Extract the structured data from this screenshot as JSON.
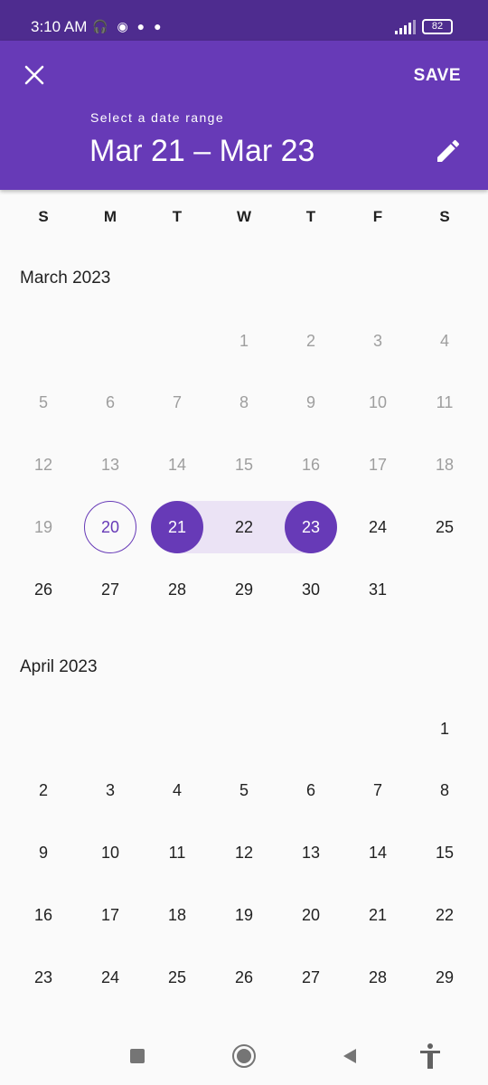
{
  "status_bar": {
    "time": "3:10 AM",
    "battery": "82"
  },
  "header": {
    "save_label": "SAVE",
    "caption": "Select a date range",
    "range_value": "Mar 21 – Mar 23"
  },
  "weekdays": [
    "S",
    "M",
    "T",
    "W",
    "T",
    "F",
    "S"
  ],
  "months": [
    {
      "title": "March 2023",
      "rows": [
        [
          "",
          "",
          "",
          "1",
          "2",
          "3",
          "4"
        ],
        [
          "5",
          "6",
          "7",
          "8",
          "9",
          "10",
          "11"
        ],
        [
          "12",
          "13",
          "14",
          "15",
          "16",
          "17",
          "18"
        ],
        [
          "19",
          "20",
          "21",
          "22",
          "23",
          "24",
          "25"
        ],
        [
          "26",
          "27",
          "28",
          "29",
          "30",
          "31",
          ""
        ]
      ]
    },
    {
      "title": "April 2023",
      "rows": [
        [
          "",
          "",
          "",
          "",
          "",
          "",
          "1"
        ],
        [
          "2",
          "3",
          "4",
          "5",
          "6",
          "7",
          "8"
        ],
        [
          "9",
          "10",
          "11",
          "12",
          "13",
          "14",
          "15"
        ],
        [
          "16",
          "17",
          "18",
          "19",
          "20",
          "21",
          "22"
        ],
        [
          "23",
          "24",
          "25",
          "26",
          "27",
          "28",
          "29"
        ]
      ]
    }
  ],
  "colors": {
    "primary": "#673ab7",
    "status_bar": "#4e2c8f",
    "range_fill": "#ebe3f5",
    "disabled_text": "#9e9e9e"
  }
}
